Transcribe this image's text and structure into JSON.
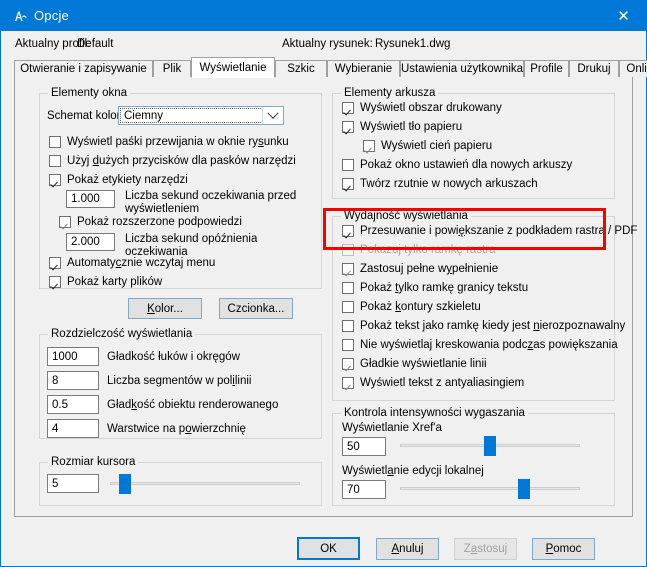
{
  "window": {
    "title": "Opcje",
    "icon": "autocad-options-icon",
    "close_label": "✕"
  },
  "header": {
    "profile_label": "Aktualny profil:",
    "profile_value": "Default",
    "drawing_label": "Aktualny rysunek:",
    "drawing_value": "Rysunek1.dwg"
  },
  "tabs": [
    {
      "label": "Otwieranie i zapisywanie",
      "active": false
    },
    {
      "label": "Plik",
      "active": false
    },
    {
      "label": "Wyświetlanie",
      "active": true
    },
    {
      "label": "Szkic",
      "active": false
    },
    {
      "label": "Wybieranie",
      "active": false
    },
    {
      "label": "Ustawienia użytkownika",
      "active": false
    },
    {
      "label": "Profile",
      "active": false
    },
    {
      "label": "Drukuj",
      "active": false
    },
    {
      "label": "Online",
      "active": false
    }
  ],
  "window_elements": {
    "group_label": "Elementy okna",
    "color_scheme_label": "Schemat koloru",
    "color_scheme_value": "Ciemny",
    "checkboxes": [
      {
        "label": "Wyświetl paśki przewijania w oknie rysunku",
        "checked": false,
        "enabled": true
      },
      {
        "label": "Użyj dużych przycisków dla pasków narzędzi",
        "checked": false,
        "enabled": true
      },
      {
        "label": "Pokaż etykiety narzędzi",
        "checked": true,
        "enabled": true
      },
      {
        "label": "Pokaż rozszerzone podpowiedzi",
        "checked": true,
        "enabled": true
      },
      {
        "label": "Automatycznie wczytaj menu",
        "checked": true,
        "enabled": true
      },
      {
        "label": "Pokaż karty plików",
        "checked": true,
        "enabled": true
      }
    ],
    "tooltip_delay_value": "1.000",
    "tooltip_delay_label": "Liczba sekund oczekiwania przed wyświetleniem",
    "extended_delay_value": "2.000",
    "extended_delay_label": "Liczba sekund opóźnienia oczekiwania",
    "color_button": "Kolor...",
    "font_button": "Czcionka..."
  },
  "resolution": {
    "group_label": "Rozdzielczość wyświetlania",
    "rows": [
      {
        "value": "1000",
        "label": "Gładkość łuków i okręgów"
      },
      {
        "value": "8",
        "label": "Liczba segmentów w polilinii"
      },
      {
        "value": "0.5",
        "label": "Gładkość obiektu renderowanego"
      },
      {
        "value": "4",
        "label": "Warstwice na powierzchnię"
      }
    ]
  },
  "cursor_size": {
    "group_label": "Rozmiar kursora",
    "value": "5",
    "slider_percent": 5
  },
  "layout_elements": {
    "group_label": "Elementy arkusza",
    "checkboxes": [
      {
        "label": "Wyświetl obszar drukowany",
        "checked": true,
        "enabled": true,
        "indent": 0
      },
      {
        "label": "Wyświetl tło papieru",
        "checked": true,
        "enabled": true,
        "indent": 0
      },
      {
        "label": "Wyświetl cień papieru",
        "checked": true,
        "enabled": false,
        "indent": 1
      },
      {
        "label": "Pokaż okno ustawień dla nowych arkuszy",
        "checked": false,
        "enabled": true,
        "indent": 0
      },
      {
        "label": "Twórz rzutnie w nowych arkuszach",
        "checked": true,
        "enabled": true,
        "indent": 0
      }
    ]
  },
  "display_performance": {
    "group_label": "Wydajność wyświetlania",
    "highlight_color": "#f60000",
    "checkboxes": [
      {
        "label": "Przesuwanie i powiększanie z podkładem rastra / PDF",
        "checked": true,
        "enabled": true,
        "highlighted": true
      },
      {
        "label": "Pokazuj tylko ramkę rastra",
        "checked": false,
        "enabled": false,
        "highlighted": false
      },
      {
        "label": "Zastosuj pełne wypełnienie",
        "checked": true,
        "enabled": true,
        "highlighted": false
      },
      {
        "label": "Pokaż tylko ramkę granicy tekstu",
        "checked": false,
        "enabled": true,
        "highlighted": false
      },
      {
        "label": "Pokaż kontury szkieletu",
        "checked": false,
        "enabled": true,
        "highlighted": false
      },
      {
        "label": "Pokaż tekst jako ramkę kiedy jest nierozpoznawalny",
        "checked": false,
        "enabled": true,
        "highlighted": false
      },
      {
        "label": "Nie wyświetlaj kreskowania podczas powiększania",
        "checked": false,
        "enabled": true,
        "highlighted": false
      },
      {
        "label": "Gładkie wyświetlanie linii",
        "checked": true,
        "enabled": true,
        "highlighted": false
      },
      {
        "label": "Wyświetl tekst z antyaliasingiem",
        "checked": true,
        "enabled": true,
        "highlighted": false
      }
    ]
  },
  "fade_control": {
    "group_label": "Kontrola intensywności wygaszania",
    "xref_label": "Wyświetlanie Xref'a",
    "xref_value": "50",
    "xref_percent": 50,
    "inplace_label": "Wyświetlanie edycji lokalnej",
    "inplace_value": "70",
    "inplace_percent": 70
  },
  "buttons": {
    "ok": "OK",
    "cancel": "Anuluj",
    "apply": "Zastosuj",
    "help": "Pomoc"
  }
}
